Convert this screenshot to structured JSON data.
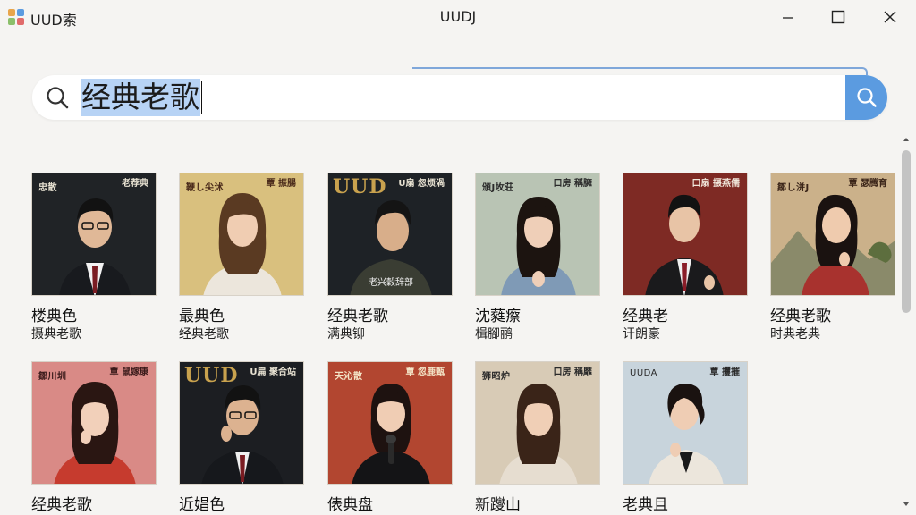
{
  "window": {
    "app_title": "UUD索",
    "title": "UUDJ"
  },
  "search": {
    "query": "经典老歌"
  },
  "colors": {
    "accent": "#5b9be0",
    "selection": "#b7d3f5"
  },
  "albums": [
    {
      "title": "楼典色",
      "subtitle": "摄典老歌",
      "cover_left": "忠散",
      "cover_right": "老荐典",
      "cover_brand": "",
      "cover_bottom": ""
    },
    {
      "title": "最典色",
      "subtitle": "经典老歌",
      "cover_left": "鞭し尖沭",
      "cover_right": "覃 振腸",
      "cover_brand": "",
      "cover_bottom": ""
    },
    {
      "title": "经典老歌",
      "subtitle": "满典铆",
      "cover_left": "",
      "cover_right": "U扇 忽烦渦",
      "cover_brand": "UUD",
      "cover_bottom": "老兴穀辞部"
    },
    {
      "title": "沈蕤瘵",
      "subtitle": "楫腳鹂",
      "cover_left": "頒J坆荘",
      "cover_right": "口房 稱臃",
      "cover_brand": "",
      "cover_bottom": ""
    },
    {
      "title": "经典老",
      "subtitle": "讦朗豪",
      "cover_left": "",
      "cover_right": "口扇 摄燕儒",
      "cover_brand": "",
      "cover_bottom": ""
    },
    {
      "title": "经典老歌",
      "subtitle": "时典老典",
      "cover_left": "鄒し洴J",
      "cover_right": "覃 瑟腾育",
      "cover_brand": "",
      "cover_bottom": ""
    },
    {
      "title": "经典老歌",
      "subtitle": "",
      "cover_left": "鄒川圳",
      "cover_right": "覃 鼠嫁康",
      "cover_brand": "",
      "cover_bottom": ""
    },
    {
      "title": "近娼色",
      "subtitle": "",
      "cover_left": "",
      "cover_right": "U扁 聚合站",
      "cover_brand": "UUD",
      "cover_bottom": ""
    },
    {
      "title": "俵典盘",
      "subtitle": "",
      "cover_left": "天沁散",
      "cover_right": "覃 忽鹿甄",
      "cover_brand": "",
      "cover_bottom": ""
    },
    {
      "title": "新躞山",
      "subtitle": "",
      "cover_left": "狮昭炉",
      "cover_right": "口房 稱靡",
      "cover_brand": "",
      "cover_bottom": ""
    },
    {
      "title": "老典且",
      "subtitle": "",
      "cover_left": "UUDA",
      "cover_right": "覃 攫摧",
      "cover_brand": "",
      "cover_bottom": ""
    }
  ]
}
